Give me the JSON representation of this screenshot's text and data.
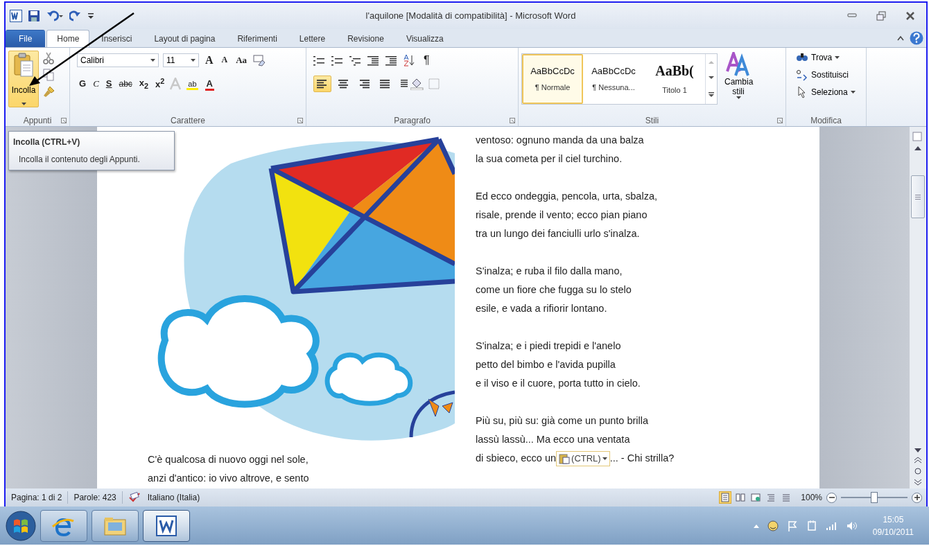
{
  "window": {
    "title": "l'aquilone [Modalità di compatibilità] - Microsoft Word"
  },
  "tabs": [
    {
      "label": "File",
      "kind": "file",
      "selected": false
    },
    {
      "label": "Home",
      "kind": "tab",
      "selected": true
    },
    {
      "label": "Inserisci",
      "kind": "tab",
      "selected": false
    },
    {
      "label": "Layout di pagina",
      "kind": "tab",
      "selected": false
    },
    {
      "label": "Riferimenti",
      "kind": "tab",
      "selected": false
    },
    {
      "label": "Lettere",
      "kind": "tab",
      "selected": false
    },
    {
      "label": "Revisione",
      "kind": "tab",
      "selected": false
    },
    {
      "label": "Visualizza",
      "kind": "tab",
      "selected": false
    }
  ],
  "ribbon": {
    "clipboard": {
      "label": "Appunti",
      "paste": {
        "label": "Incolla",
        "highlighted": true
      }
    },
    "font": {
      "label": "Carattere",
      "font_name": "Calibri",
      "font_size": "11",
      "size_buttons": [
        "A",
        "A"
      ],
      "case_button": "Aa",
      "format_buttons": [
        {
          "label": "G",
          "kind": "bold"
        },
        {
          "label": "C",
          "kind": "italic"
        },
        {
          "label": "S",
          "kind": "underline"
        },
        {
          "label": "abc",
          "kind": "strike"
        },
        {
          "label": "x$_{2}$",
          "kind": "plain"
        },
        {
          "label": "x$^{2}$",
          "kind": "plain"
        }
      ],
      "highlight_label": "ab",
      "color_label": "A"
    },
    "paragraph": {
      "label": "Paragrafo",
      "marks_label": "¶",
      "align_buttons": [
        {
          "kind": "left",
          "selected": true
        },
        {
          "kind": "center",
          "selected": false
        },
        {
          "kind": "right",
          "selected": false
        },
        {
          "kind": "justify",
          "selected": false
        }
      ]
    },
    "styles": {
      "label": "Stili",
      "items": [
        {
          "sample": "AaBbCcDc",
          "name": "¶ Normale",
          "kind": "body",
          "selected": true
        },
        {
          "sample": "AaBbCcDc",
          "name": "¶ Nessuna...",
          "kind": "body",
          "selected": false
        },
        {
          "sample": "AaBb(",
          "name": "Titolo 1",
          "kind": "heading",
          "selected": false
        }
      ],
      "change_styles": "Cambia stili"
    },
    "editing": {
      "label": "Modifica",
      "items": [
        {
          "label": "Trova",
          "kind": "find",
          "has_menu": true
        },
        {
          "label": "Sostituisci",
          "kind": "replace",
          "has_menu": false
        },
        {
          "label": "Seleziona",
          "kind": "select",
          "has_menu": true
        }
      ]
    }
  },
  "tooltip": {
    "title": "Incolla (CTRL+V)",
    "body": "Incolla il contenuto degli Appunti."
  },
  "document": {
    "left_lines": [
      "C'è qualcosa di nuovo oggi nel sole,",
      "anzi d'antico: io vivo altrove, e sento"
    ],
    "right_stanzas": [
      [
        {
          "kind": "text",
          "text": "ventoso: ognuno manda da una balza"
        },
        {
          "kind": "text",
          "text": "la sua cometa per il ciel turchino."
        }
      ],
      [
        {
          "kind": "text",
          "text": "Ed ecco ondeggia, pencola, urta, sbalza,"
        },
        {
          "kind": "text",
          "text": "risale, prende il vento; ecco pian piano"
        },
        {
          "kind": "text",
          "text": "tra un lungo dei fanciulli urlo s'inalza."
        }
      ],
      [
        {
          "kind": "text",
          "text": "S'inalza; e ruba il filo dalla mano,"
        },
        {
          "kind": "text",
          "text": "come un fiore che fugga su lo stelo"
        },
        {
          "kind": "text",
          "text": "esile, e vada a rifiorir lontano."
        }
      ],
      [
        {
          "kind": "text",
          "text": "S'inalza; e i piedi trepidi e l'anelo"
        },
        {
          "kind": "text",
          "text": "petto del bimbo e l'avida pupilla"
        },
        {
          "kind": "text",
          "text": "e il viso e il cuore, porta tutto in cielo."
        }
      ],
      [
        {
          "kind": "text",
          "text": "Più su, più su: già come un punto brilla"
        },
        {
          "kind": "text",
          "text": "lassù lassù... Ma ecco una ventata"
        },
        {
          "kind": "paste",
          "before": "di sbieco, ecco un",
          "paste_options": "(CTRL)",
          "after": "... - Chi strilla?"
        }
      ]
    ]
  },
  "status_bar": {
    "page": "Pagina: 1 di 2",
    "words": "Parole: 423",
    "language": "Italiano (Italia)",
    "views": [
      {
        "kind": "print",
        "selected": true
      },
      {
        "kind": "read",
        "selected": false
      },
      {
        "kind": "web",
        "selected": false
      },
      {
        "kind": "outline",
        "selected": false
      },
      {
        "kind": "draft",
        "selected": false
      }
    ],
    "zoom": "100%",
    "zoom_slider": {
      "level": 0.5
    }
  },
  "taskbar": {
    "apps": [
      {
        "kind": "browser",
        "active": false
      },
      {
        "kind": "folder",
        "active": false
      },
      {
        "kind": "word",
        "active": true
      }
    ],
    "time": "15:05",
    "date": "09/10/2011"
  }
}
